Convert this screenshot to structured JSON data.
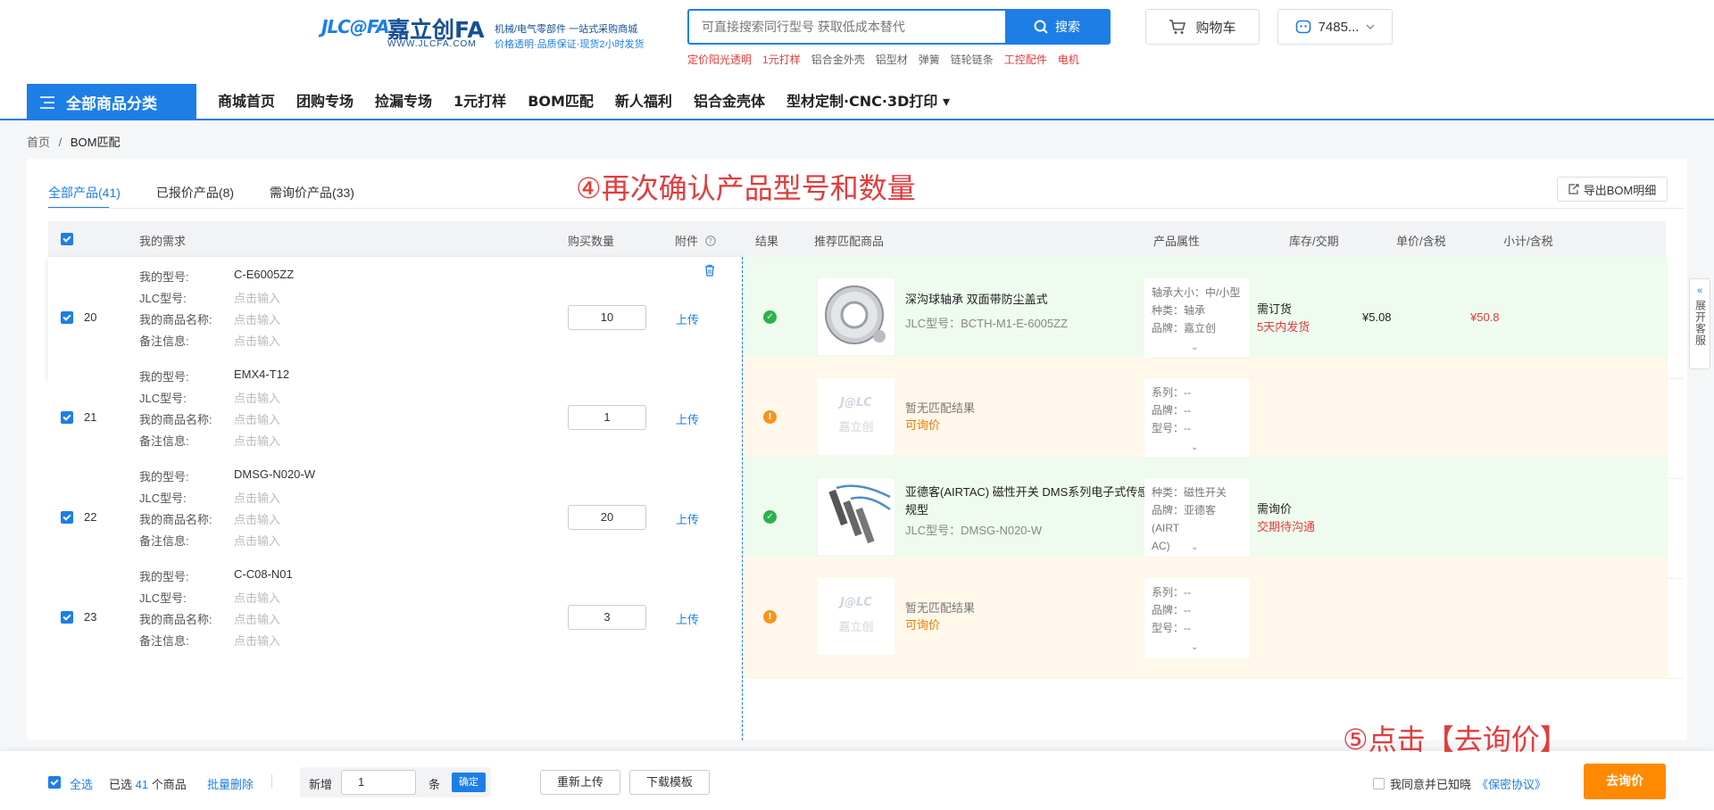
{
  "header": {
    "logo_mark": "JLC@FA",
    "logo_name": "嘉立创FA",
    "logo_url": "WWW.JLCFA.COM",
    "logo_slogan1": "机械/电气零部件 一站式采购商城",
    "logo_slogan2": "价格透明·品质保证·现货2小时发货",
    "search_placeholder": "可直接搜索同行型号 获取低成本替代",
    "search_button": "搜索",
    "hot_words": [
      {
        "text": "定价阳光透明",
        "red": true
      },
      {
        "text": "1元打样",
        "red": true
      },
      {
        "text": "铝合金外壳",
        "red": false
      },
      {
        "text": "铝型材",
        "red": false
      },
      {
        "text": "弹簧",
        "red": false
      },
      {
        "text": "链轮链条",
        "red": false
      },
      {
        "text": "工控配件",
        "red": true
      },
      {
        "text": "电机",
        "red": true
      }
    ],
    "cart_label": "购物车",
    "user_label": "7485..."
  },
  "nav": {
    "category_label": "全部商品分类",
    "items": [
      "商城首页",
      "团购专场",
      "捡漏专场",
      "1元打样",
      "BOM匹配",
      "新人福利",
      "铝合金壳体",
      "型材定制·CNC·3D打印 ▾"
    ]
  },
  "breadcrumb": {
    "home": "首页",
    "sep": "/",
    "current": "BOM匹配"
  },
  "tabs": [
    {
      "label": "全部产品(41)",
      "active": true
    },
    {
      "label": "已报价产品(8)",
      "active": false
    },
    {
      "label": "需询价产品(33)",
      "active": false
    }
  ],
  "export_label": "导出BOM明细",
  "annotations": {
    "step4": "④再次确认产品型号和数量",
    "step5": "⑤点击【去询价】"
  },
  "table": {
    "headers": {
      "req": "我的需求",
      "qty": "购买数量",
      "attach": "附件",
      "result": "结果",
      "match": "推荐匹配商品",
      "attr": "产品属性",
      "stock": "库存/交期",
      "price": "单价/含税",
      "subtotal": "小计/含税"
    },
    "field_labels": {
      "model": "我的型号:",
      "jlc": "JLC型号:",
      "name": "我的商品名称:",
      "note": "备注信息:"
    },
    "placeholder": "点击输入",
    "upload": "上传",
    "rows": [
      {
        "idx": "20",
        "model": "C-E6005ZZ",
        "qty": "10",
        "status": "ok",
        "product_name": "深沟球轴承 双面带防尘盖式",
        "product_code": "JLC型号：BCTH-M1-E-6005ZZ",
        "attrs": [
          "轴承大小：中/小型",
          "种类：轴承",
          "品牌：嘉立创"
        ],
        "stock": "需订货",
        "lead": "5天内发货",
        "price": "¥5.08",
        "subtotal": "¥50.8"
      },
      {
        "idx": "21",
        "model": "EMX4-T12",
        "qty": "1",
        "status": "warn",
        "no_match": "暂无匹配结果",
        "ask": "可询价",
        "attrs": [
          "系列：--",
          "品牌：--",
          "型号：--"
        ]
      },
      {
        "idx": "22",
        "model": "DMSG-N020-W",
        "qty": "20",
        "status": "ok",
        "product_name": "亚德客(AIRTAC) 磁性开关 DMS系列电子式传感器 常规型",
        "product_code": "JLC型号：DMSG-N020-W",
        "attrs": [
          "种类：磁性开关",
          "品牌：亚德客(AIRT",
          "AC)"
        ],
        "stock": "需询价",
        "lead": "交期待沟通"
      },
      {
        "idx": "23",
        "model": "C-C08-N01",
        "qty": "3",
        "status": "warn",
        "no_match": "暂无匹配结果",
        "ask": "可询价",
        "attrs": [
          "系列：--",
          "品牌：--",
          "型号：--"
        ]
      }
    ],
    "placeholder_logo": "J@LC",
    "placeholder_brand": "嘉立创"
  },
  "footer": {
    "select_all": "全选",
    "selected_prefix": "已选",
    "selected_count": "41",
    "selected_suffix": "个商品",
    "batch_delete": "批量删除",
    "add_label": "新增",
    "add_value": "1",
    "add_unit": "条",
    "confirm": "确定",
    "reupload": "重新上传",
    "download_template": "下载模板",
    "agree_text": "我同意并已知晓",
    "privacy_link": "《保密协议》",
    "inquiry_button": "去询价"
  },
  "side_service": "展开客服",
  "colors": {
    "brand": "#1d7ee6",
    "accent_red": "#e23c3c",
    "cta": "#ff8a00",
    "match_bg": "#eefbee",
    "nomatch_bg": "#fff7ea"
  }
}
